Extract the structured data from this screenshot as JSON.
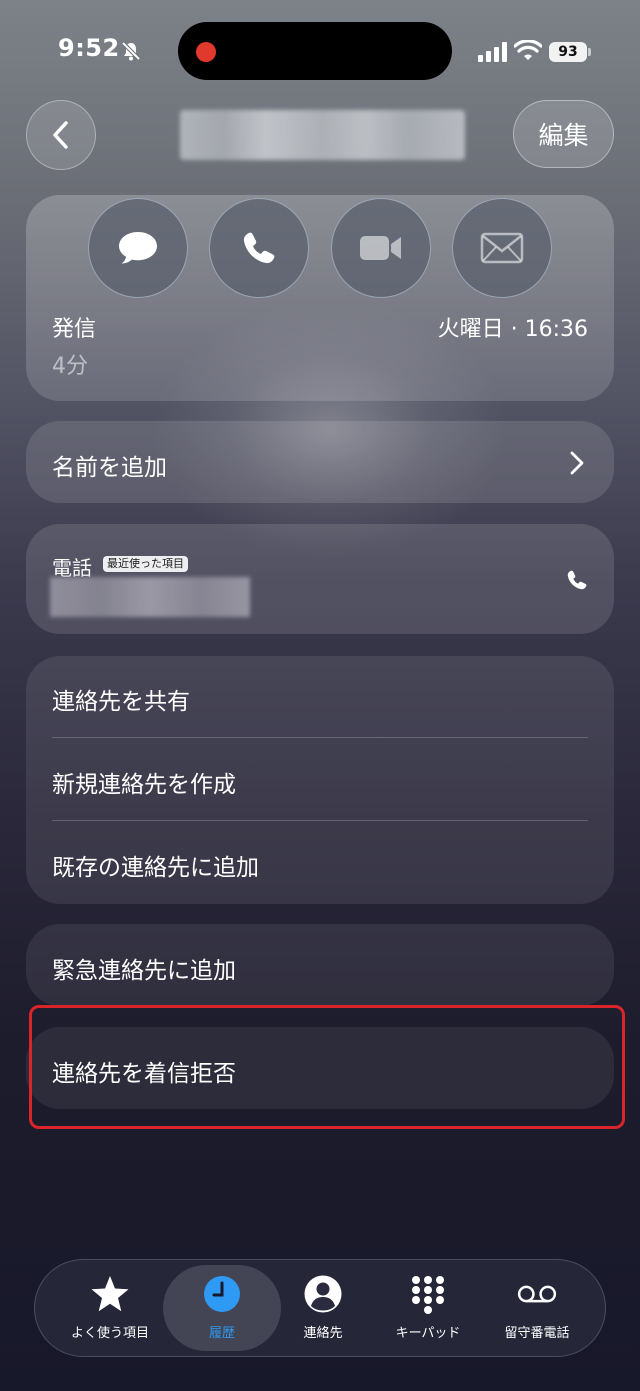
{
  "status_bar": {
    "time": "9:52",
    "battery": "93"
  },
  "header": {
    "edit_label": "編集"
  },
  "recent_call": {
    "type": "発信",
    "duration": "4分",
    "time": "火曜日 · 16:36"
  },
  "actions": [
    {
      "icon": "message-icon"
    },
    {
      "icon": "phone-icon"
    },
    {
      "icon": "video-icon"
    },
    {
      "icon": "mail-icon"
    }
  ],
  "add_name": {
    "label": "名前を追加"
  },
  "phone": {
    "label": "電話",
    "badge": "最近使った項目"
  },
  "contact_options": [
    {
      "label": "連絡先を共有"
    },
    {
      "label": "新規連絡先を作成"
    },
    {
      "label": "既存の連絡先に追加"
    }
  ],
  "emergency": {
    "label": "緊急連絡先に追加"
  },
  "block": {
    "label": "連絡先を着信拒否"
  },
  "tabbar": {
    "items": [
      {
        "label": "よく使う項目",
        "icon": "star-icon"
      },
      {
        "label": "履歴",
        "icon": "clock-icon",
        "active": true
      },
      {
        "label": "連絡先",
        "icon": "person-icon"
      },
      {
        "label": "キーパッド",
        "icon": "keypad-icon"
      },
      {
        "label": "留守番電話",
        "icon": "voicemail-icon"
      }
    ],
    "active_color": "#2f9af3"
  },
  "colors": {
    "highlight_border": "#d9242a",
    "recording_dot": "#e2392f"
  }
}
